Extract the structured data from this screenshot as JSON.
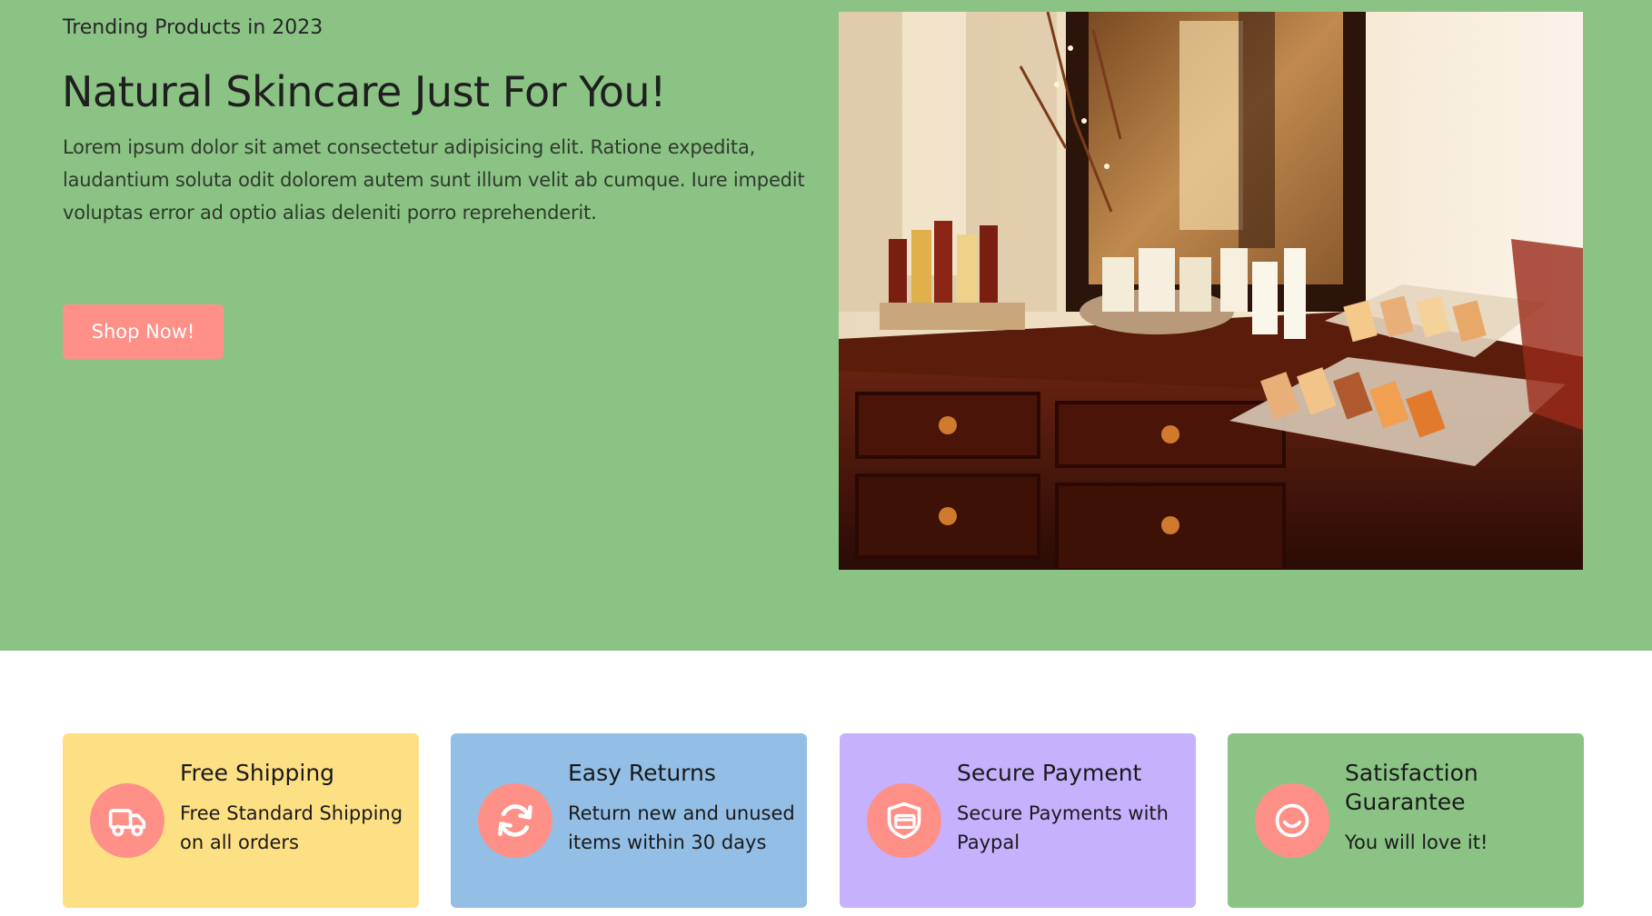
{
  "hero": {
    "eyebrow": "Trending Products in 2023",
    "title": "Natural Skincare Just For You!",
    "text": "Lorem ipsum dolor sit amet consectetur adipisicing elit. Ratione expedita, laudantium soluta odit dolorem autem sunt illum velit ab cumque. Iure impedit voluptas error ad optio alias deleniti porro reprehenderit.",
    "cta_label": "Shop Now!",
    "image_subject": "skincare products displayed on a wooden dresser with mirror"
  },
  "features": [
    {
      "icon": "truck-icon",
      "title": "Free Shipping",
      "text": "Free Standard Shipping on all orders",
      "color": "#fee084"
    },
    {
      "icon": "refresh-icon",
      "title": "Easy Returns",
      "text": "Return new and unused items within 30 days",
      "color": "#93bfe6"
    },
    {
      "icon": "secure-payment-icon",
      "title": "Secure Payment",
      "text": "Secure Payments with Paypal",
      "color": "#c5b1fd"
    },
    {
      "icon": "smiley-icon",
      "title": "Satisfaction Guarantee",
      "text": "You will love it!",
      "color": "#8bc385"
    }
  ],
  "colors": {
    "hero_bg": "#8bc385",
    "accent": "#fe9088"
  }
}
